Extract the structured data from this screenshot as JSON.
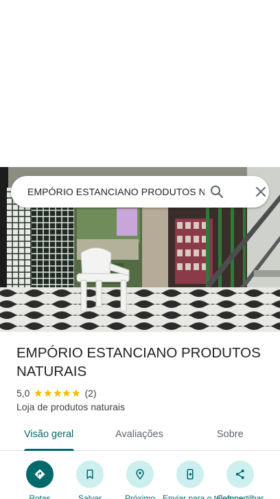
{
  "search": {
    "query": "EMPÓRIO ESTANCIANO PRODUTOS NATURAIS"
  },
  "place": {
    "name": "EMPÓRIO ESTANCIANO PRODUTOS NATURAIS",
    "rating": "5,0",
    "stars": 5,
    "review_count": "(2)",
    "category": "Loja de produtos naturais"
  },
  "tabs": [
    {
      "label": "Visão geral",
      "active": true
    },
    {
      "label": "Avaliações",
      "active": false
    },
    {
      "label": "Sobre",
      "active": false
    }
  ],
  "actions": [
    {
      "label": "Rotas",
      "icon": "directions-icon"
    },
    {
      "label": "Salvar",
      "icon": "bookmark-icon"
    },
    {
      "label": "Próximo",
      "icon": "nearby-icon"
    },
    {
      "label": "Enviar para o telefone",
      "icon": "send-to-phone-icon"
    },
    {
      "label": "Compartilhar",
      "icon": "share-icon"
    }
  ],
  "colors": {
    "accent": "#00696b",
    "accent_light": "#cdeff0",
    "star": "#fbbc04"
  }
}
